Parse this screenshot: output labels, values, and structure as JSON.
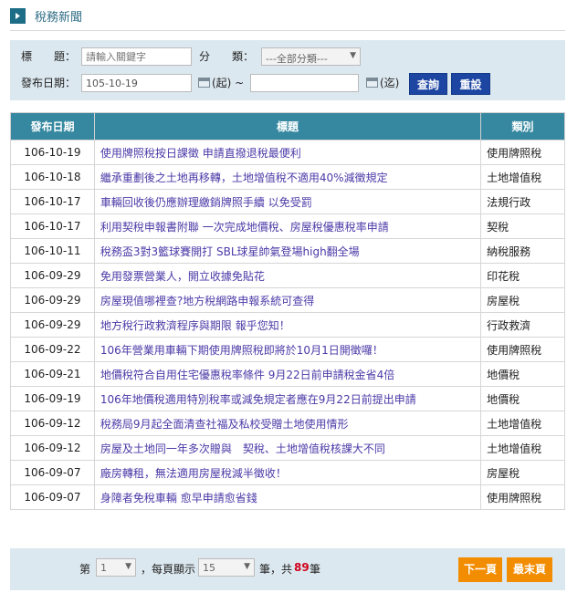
{
  "header": {
    "title": "稅務新聞"
  },
  "search": {
    "title_label": "標　　題：",
    "title_placeholder": "請輸入關鍵字",
    "category_label": "分　　類：",
    "category_value": "---全部分類---",
    "date_label": "發布日期：",
    "date_start": "105-10-19",
    "date_end": "",
    "start_suffix": "(起) ~",
    "end_suffix": "(迄)",
    "query_label": "查詢",
    "reset_label": "重設"
  },
  "table": {
    "headers": [
      "發布日期",
      "標題",
      "類別"
    ],
    "rows": [
      {
        "date": "106-10-19",
        "title": "使用牌照稅按日課徵 申請直撥退稅最便利",
        "category": "使用牌照稅"
      },
      {
        "date": "106-10-18",
        "title": "繼承重劃後之土地再移轉，土地增值稅不適用40%減徵規定",
        "category": "土地增值稅"
      },
      {
        "date": "106-10-17",
        "title": "車輛回收後仍應辦理繳銷牌照手續 以免受罰",
        "category": "法規行政"
      },
      {
        "date": "106-10-17",
        "title": "利用契稅申報書附聯 一次完成地價稅、房屋稅優惠稅率申請",
        "category": "契稅"
      },
      {
        "date": "106-10-11",
        "title": "稅務盃3對3籃球賽開打 SBL球星帥氣登場high翻全場",
        "category": "納稅服務"
      },
      {
        "date": "106-09-29",
        "title": "免用發票營業人，開立收據免貼花",
        "category": "印花稅"
      },
      {
        "date": "106-09-29",
        "title": "房屋現值哪裡查?地方稅網路申報系統可查得",
        "category": "房屋稅"
      },
      {
        "date": "106-09-29",
        "title": "地方稅行政救濟程序與期限 報乎您知！",
        "category": "行政救濟"
      },
      {
        "date": "106-09-22",
        "title": "106年營業用車輛下期使用牌照稅即將於10月1日開徵囉！",
        "category": "使用牌照稅"
      },
      {
        "date": "106-09-21",
        "title": "地價稅符合自用住宅優惠稅率條件 9月22日前申請稅金省4倍",
        "category": "地價稅"
      },
      {
        "date": "106-09-19",
        "title": "106年地價稅適用特別稅率或減免規定者應在9月22日前提出申請",
        "category": "地價稅"
      },
      {
        "date": "106-09-12",
        "title": "稅務局9月起全面清查社福及私校受贈土地使用情形",
        "category": "土地增值稅"
      },
      {
        "date": "106-09-12",
        "title": "房屋及土地同一年多次贈與　契稅、土地增值稅核課大不同",
        "category": "土地增值稅"
      },
      {
        "date": "106-09-07",
        "title": "廠房轉租，無法適用房屋稅減半徵收！",
        "category": "房屋稅"
      },
      {
        "date": "106-09-07",
        "title": "身障者免稅車輛 愈早申請愈省錢",
        "category": "使用牌照稅"
      }
    ]
  },
  "pager": {
    "page_prefix": "第",
    "page_value": "1",
    "per_page_prefix": "，每頁顯示",
    "per_page_value": "15",
    "suffix_before_total": "筆，共",
    "total": "89",
    "suffix_after_total": "筆",
    "next_label": "下一頁",
    "last_label": "最末頁"
  },
  "colors": {
    "accent": "#3588a0",
    "button": "#1d46a3",
    "pager_button": "#f28c00",
    "panel": "#dce8ef"
  },
  "icons": [
    "play-triangle-icon",
    "calendar-icon",
    "chevron-down-icon"
  ]
}
